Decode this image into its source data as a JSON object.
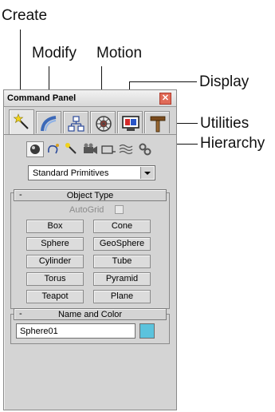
{
  "callouts": {
    "create": "Create",
    "modify": "Modify",
    "motion": "Motion",
    "display": "Display",
    "utilities": "Utilities",
    "hierarchy": "Hierarchy"
  },
  "panel": {
    "title": "Command Panel",
    "close_glyph": "✕",
    "tabs": [
      {
        "name": "create",
        "icon": "wand-icon",
        "active": true
      },
      {
        "name": "modify",
        "icon": "modify-curve-icon",
        "active": false
      },
      {
        "name": "hierarchy",
        "icon": "hierarchy-icon",
        "active": false
      },
      {
        "name": "motion",
        "icon": "motion-wheel-icon",
        "active": false
      },
      {
        "name": "display",
        "icon": "monitor-icon",
        "active": false
      },
      {
        "name": "utilities",
        "icon": "hammer-icon",
        "active": false
      }
    ],
    "subcategories": [
      "geometry-icon",
      "shapes-icon",
      "lights-icon",
      "cameras-icon",
      "helpers-icon",
      "space-warps-icon",
      "systems-icon"
    ],
    "dropdown_value": "Standard Primitives",
    "object_type": {
      "header_minus": "-",
      "header_label": "Object Type",
      "autogrid_label": "AutoGrid",
      "buttons": [
        "Box",
        "Cone",
        "Sphere",
        "GeoSphere",
        "Cylinder",
        "Tube",
        "Torus",
        "Pyramid",
        "Teapot",
        "Plane"
      ]
    },
    "name_color": {
      "header_minus": "-",
      "header_label": "Name and Color",
      "name_value": "Sphere01",
      "color": "#5bc3dd"
    }
  }
}
